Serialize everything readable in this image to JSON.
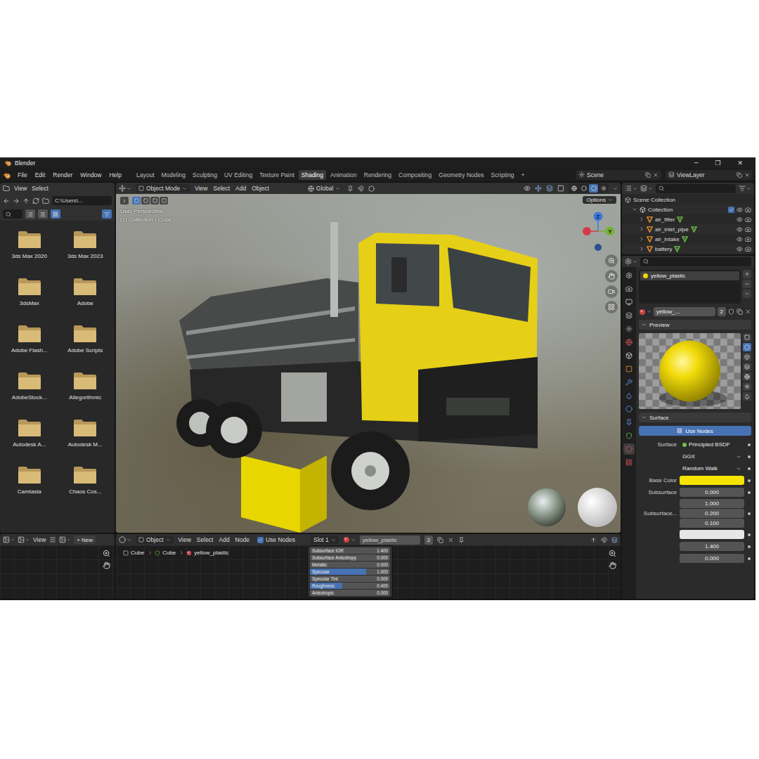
{
  "window": {
    "title": "Blender",
    "controls": [
      "─",
      "❐",
      "✕"
    ]
  },
  "menu": [
    "File",
    "Edit",
    "Render",
    "Window",
    "Help"
  ],
  "workspaces": [
    {
      "label": "Layout",
      "selected": false
    },
    {
      "label": "Modeling",
      "selected": false
    },
    {
      "label": "Sculpting",
      "selected": false
    },
    {
      "label": "UV Editing",
      "selected": false
    },
    {
      "label": "Texture Paint",
      "selected": false
    },
    {
      "label": "Shading",
      "selected": true
    },
    {
      "label": "Animation",
      "selected": false
    },
    {
      "label": "Rendering",
      "selected": false
    },
    {
      "label": "Compositing",
      "selected": false
    },
    {
      "label": "Geometry Nodes",
      "selected": false
    },
    {
      "label": "Scripting",
      "selected": false
    }
  ],
  "add_workspace": "+",
  "scene": "Scene",
  "view_layer": "ViewLayer",
  "file_browser": {
    "menu": [
      "View",
      "Select"
    ],
    "path": "C:\\Users\\...",
    "view_modes": [
      {
        "selected": false
      },
      {
        "selected": false
      },
      {
        "selected": true
      }
    ],
    "folders": [
      "3ds Max 2020",
      "3ds Max 2023",
      "3dsMax",
      "Adobe",
      "Adobe Flash...",
      "Adobe Scripts",
      "AdobeStock...",
      "Allegorithmic",
      "Autodesk A...",
      "Autodesk M...",
      "Camtasia",
      "Chaos Cos..."
    ]
  },
  "viewport": {
    "mode": "Object Mode",
    "menu": [
      "View",
      "Select",
      "Add",
      "Object"
    ],
    "orientation": "Global",
    "options": "Options",
    "info": [
      "User Perspective",
      "(1) Collection | Cube"
    ],
    "select_modes": [
      {
        "selected": true
      },
      {
        "selected": false
      },
      {
        "selected": false
      },
      {
        "selected": false
      }
    ],
    "shading_modes": [
      {
        "selected": false
      },
      {
        "selected": false
      },
      {
        "selected": true
      },
      {
        "selected": false
      }
    ],
    "axes": [
      {
        "label": "Z",
        "color": "#3b78e0"
      },
      {
        "label": "Y",
        "color": "#74b233"
      }
    ]
  },
  "outliner": {
    "root": "Scene Collection",
    "collection": {
      "label": "Collection",
      "checked": true,
      "expanded": true
    },
    "items": [
      {
        "name": "air_filter",
        "expanded": false
      },
      {
        "name": "air_inlet_pipe",
        "expanded": false
      },
      {
        "name": "air_intake",
        "expanded": false
      },
      {
        "name": "battery",
        "expanded": false
      }
    ]
  },
  "properties": {
    "property_tabs": [
      {
        "selected": false
      },
      {
        "selected": false
      },
      {
        "selected": false
      },
      {
        "selected": false
      },
      {
        "selected": false
      },
      {
        "selected": false
      },
      {
        "selected": false
      },
      {
        "selected": false
      },
      {
        "selected": false
      },
      {
        "selected": false
      },
      {
        "selected": false
      },
      {
        "selected": false
      },
      {
        "selected": false
      },
      {
        "selected": true
      },
      {
        "selected": false
      }
    ],
    "slots": [
      {
        "name": "yellow_plastic",
        "selected": true
      }
    ],
    "material": {
      "name": "yellow_...",
      "users": "2"
    },
    "preview": "Preview",
    "preview_shapes": [
      {
        "selected": false
      },
      {
        "selected": true
      },
      {
        "selected": false
      },
      {
        "selected": false
      },
      {
        "selected": false
      },
      {
        "selected": false
      },
      {
        "selected": false
      }
    ],
    "surface": "Surface",
    "use_nodes": "Use Nodes",
    "rows": [
      {
        "kind": "shader",
        "label": "Surface",
        "value": "Principled BSDF"
      },
      {
        "kind": "dropdown",
        "value": "GGX"
      },
      {
        "kind": "dropdown",
        "value": "Random Walk"
      },
      {
        "kind": "color",
        "label": "Base Color",
        "color": "#f5e400"
      },
      {
        "kind": "number",
        "label": "Subsurface",
        "value": "0.000"
      },
      {
        "kind": "vector",
        "label": "Subsurface...",
        "values": [
          "1.000",
          "0.200",
          "0.100"
        ]
      },
      {
        "kind": "color",
        "color": "#e6e6e6"
      },
      {
        "kind": "number",
        "value": "1.400"
      },
      {
        "kind": "number",
        "value": "0.000"
      }
    ]
  },
  "image_editor": {
    "menu": "View",
    "new_icon": "+",
    "new": "New"
  },
  "shader_editor": {
    "mode": "Object",
    "menu": [
      "View",
      "Select",
      "Add",
      "Node"
    ],
    "use_nodes": {
      "label": "Use Nodes",
      "checked": true
    },
    "slot": "Slot 1",
    "material": "yellow_plastic",
    "users": "2",
    "breadcrumb": [
      "Cube",
      "Cube",
      "yellow_plastic"
    ],
    "node_rows": [
      {
        "label": "Subsurface IOR",
        "value": "1.400",
        "level": 0
      },
      {
        "label": "Subsurface Anisotropy",
        "value": "0.000",
        "level": 0
      },
      {
        "label": "Metallic",
        "value": "0.000",
        "level": 0
      },
      {
        "label": "Specular",
        "value": "1.000",
        "level": 0.7
      },
      {
        "label": "Specular Tint",
        "value": "0.000",
        "level": 0
      },
      {
        "label": "Roughness",
        "value": "0.400",
        "level": 0.4
      },
      {
        "label": "Anisotropic",
        "value": "0.000",
        "level": 0
      }
    ]
  }
}
